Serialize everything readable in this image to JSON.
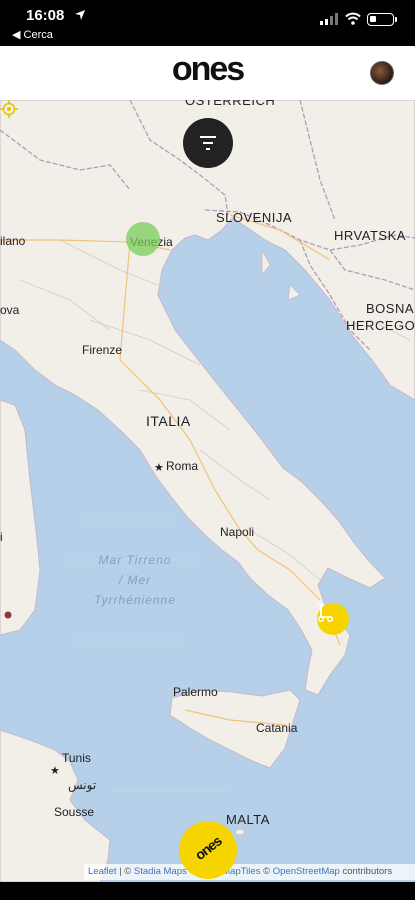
{
  "status_bar": {
    "time": "16:08",
    "back_label": "◀ Cerca",
    "icons": [
      "location-arrow-icon",
      "signal-icon",
      "wifi-icon",
      "battery-icon"
    ]
  },
  "header": {
    "logo": "ones",
    "avatar": "profile-avatar"
  },
  "map": {
    "countries": [
      "ÖSTERREICH",
      "SLOVENIJA",
      "HRVATSKA",
      "BOSNA",
      "HERCEGOV",
      "ITALIA",
      "MALTA"
    ],
    "cities": [
      "ilano",
      "Venezia",
      "Firenze",
      "Roma",
      "Napoli",
      "Palermo",
      "Catania",
      "Tunis",
      "تونس",
      "Sousse",
      "ova",
      "i"
    ],
    "sea": [
      "Mar Tirreno",
      "/ Mer",
      "Tyrrhénienne"
    ],
    "attribution": {
      "leaflet": "Leaflet",
      "stadia": "Stadia Maps",
      "openmaptiles": "OpenMapTiles",
      "osm": "OpenStreetMap",
      "contributors": "contributors",
      "sep1": " | © ",
      "sep2": " © ",
      "sep3": " © "
    }
  },
  "controls": {
    "filter_icon": "filter-icon",
    "locate_icon": "locate-icon",
    "fab_label": "ones"
  },
  "colors": {
    "accent_yellow": "#f6d400",
    "cluster_green": "#78cd5a",
    "sea": "#b5d0e8",
    "land": "#f2efe9"
  }
}
